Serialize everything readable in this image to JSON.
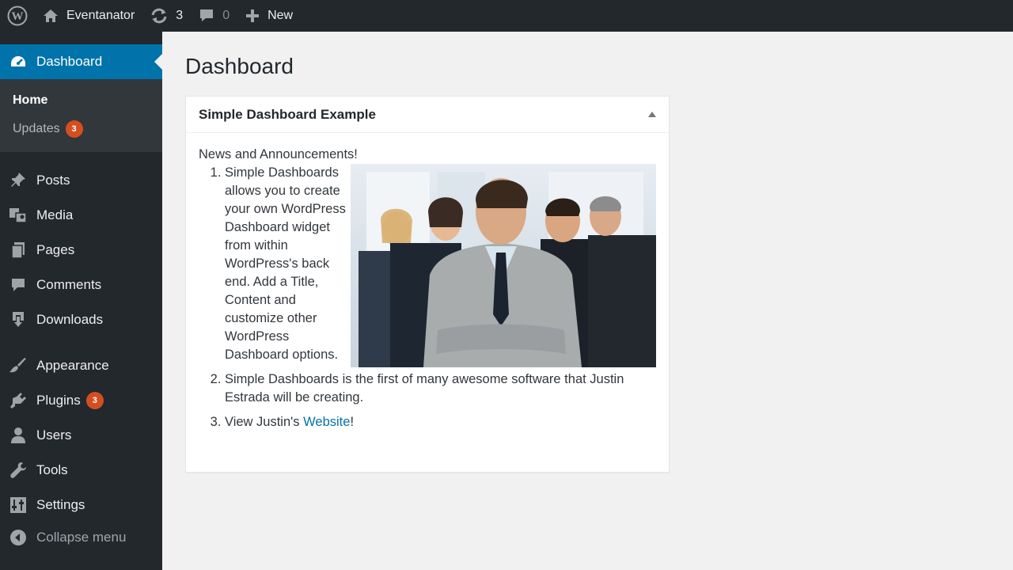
{
  "adminbar": {
    "site_name": "Eventanator",
    "updates_count": "3",
    "comments_count": "0",
    "new_label": "New"
  },
  "sidebar": {
    "current": {
      "label": "Dashboard",
      "icon": "dashboard-icon"
    },
    "submenu": {
      "home": "Home",
      "updates": "Updates",
      "updates_badge": "3"
    },
    "items": [
      {
        "label": "Posts",
        "icon": "pin-icon"
      },
      {
        "label": "Media",
        "icon": "media-icon"
      },
      {
        "label": "Pages",
        "icon": "pages-icon"
      },
      {
        "label": "Comments",
        "icon": "comment-icon"
      },
      {
        "label": "Downloads",
        "icon": "download-icon"
      },
      {
        "label": "Appearance",
        "icon": "brush-icon"
      },
      {
        "label": "Plugins",
        "icon": "plugin-icon",
        "badge": "3"
      },
      {
        "label": "Users",
        "icon": "user-icon"
      },
      {
        "label": "Tools",
        "icon": "wrench-icon"
      },
      {
        "label": "Settings",
        "icon": "settings-icon"
      }
    ],
    "collapse": "Collapse menu"
  },
  "main": {
    "page_title": "Dashboard",
    "widget": {
      "title": "Simple Dashboard Example",
      "intro": "News and Announcements!",
      "item1": "Simple Dashboards allows you to create your own WordPress Dashboard widget from within WordPress's back end. Add a Title, Content and customize other WordPress Dashboard options.",
      "item2": "Simple Dashboards is the first of many awesome software that Justin Estrada will be creating.",
      "item3_prefix": "View Justin's ",
      "item3_link": "Website",
      "item3_suffix": "!"
    }
  },
  "colors": {
    "adminbar_bg": "#23282d",
    "sidebar_bg": "#23282d",
    "submenu_bg": "#32373c",
    "accent": "#0073aa",
    "badge": "#d54e21",
    "page_bg": "#f1f1f1"
  }
}
